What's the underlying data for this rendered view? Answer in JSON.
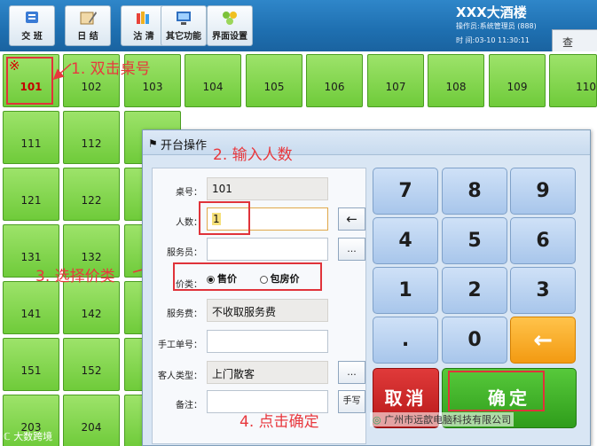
{
  "toolbar": {
    "buttons": [
      {
        "label": "交 班",
        "icon": "handover-icon"
      },
      {
        "label": "日 结",
        "icon": "daily-close-icon"
      },
      {
        "label": "沽 清",
        "icon": "sold-out-icon"
      },
      {
        "label": "其它功能",
        "icon": "other-functions-icon"
      },
      {
        "label": "界面设置",
        "icon": "interface-settings-icon"
      }
    ],
    "hotel_name": "XXX大酒楼",
    "operator": "操作员:系统管理员 (888)",
    "time": "时  间:03-10  11:30:11",
    "query_tab": "查 单"
  },
  "tables": [
    {
      "num": "101"
    },
    {
      "num": "102"
    },
    {
      "num": "103"
    },
    {
      "num": "104"
    },
    {
      "num": "105"
    },
    {
      "num": "106"
    },
    {
      "num": "107"
    },
    {
      "num": "108"
    },
    {
      "num": "109"
    },
    {
      "num": "110"
    },
    {
      "num": "111"
    },
    {
      "num": "112"
    },
    {
      "num": "121"
    },
    {
      "num": "122"
    },
    {
      "num": "131"
    },
    {
      "num": "132"
    },
    {
      "num": "141"
    },
    {
      "num": "142"
    },
    {
      "num": "151"
    },
    {
      "num": "152"
    },
    {
      "num": "203"
    },
    {
      "num": "204"
    }
  ],
  "selected_symbol": "※",
  "annotations": {
    "step1": "1. 双击桌号",
    "step2": "2. 输入人数",
    "step3": "3. 选择价类",
    "step4": "4. 点击确定"
  },
  "dialog": {
    "title": "开台操作",
    "flag_icon": "flag-icon",
    "fields": {
      "table_label": "桌号：",
      "table_value": "101",
      "people_label": "人数：",
      "people_value": "1",
      "waiter_label": "服务员：",
      "waiter_value": "",
      "price_label": "价类：",
      "price_opt1": "售价",
      "price_opt2": "包房价",
      "service_label": "服务费：",
      "service_value": "不收取服务费",
      "manual_label": "手工单号：",
      "manual_value": "",
      "guest_label": "客人类型：",
      "guest_value": "上门散客",
      "note_label": "备注：",
      "note_value": ""
    },
    "buttons": {
      "backspace_small": "←",
      "ellipsis": "...",
      "handwrite": "手写"
    },
    "keypad": [
      "7",
      "8",
      "9",
      "4",
      "5",
      "6",
      "1",
      "2",
      "3",
      ".",
      "0",
      "←"
    ],
    "cancel": "取消",
    "confirm": "确定"
  },
  "watermarks": {
    "left": "大数跨境",
    "right": "广州市远歆电脑科技有限公司"
  }
}
